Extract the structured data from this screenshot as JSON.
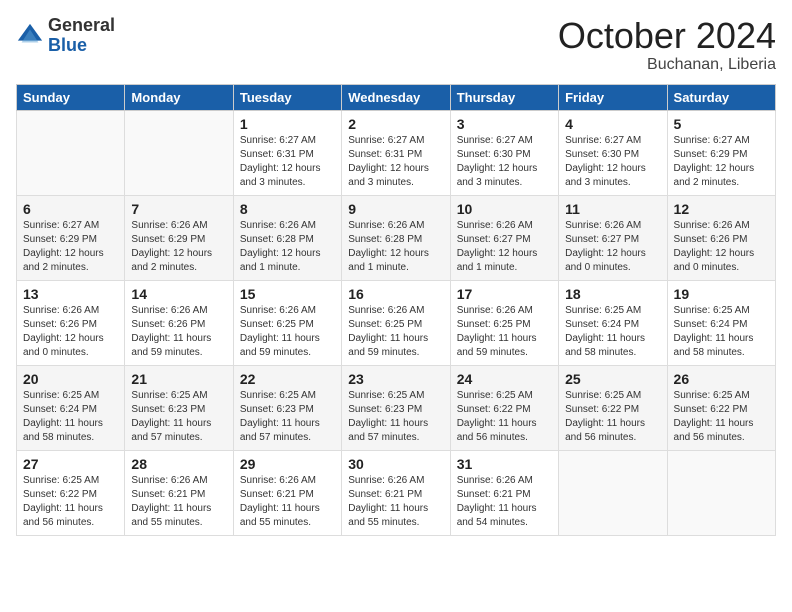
{
  "logo": {
    "general": "General",
    "blue": "Blue"
  },
  "header": {
    "month": "October 2024",
    "location": "Buchanan, Liberia"
  },
  "weekdays": [
    "Sunday",
    "Monday",
    "Tuesday",
    "Wednesday",
    "Thursday",
    "Friday",
    "Saturday"
  ],
  "weeks": [
    [
      {
        "day": null,
        "info": null
      },
      {
        "day": null,
        "info": null
      },
      {
        "day": "1",
        "info": "Sunrise: 6:27 AM\nSunset: 6:31 PM\nDaylight: 12 hours and 3 minutes."
      },
      {
        "day": "2",
        "info": "Sunrise: 6:27 AM\nSunset: 6:31 PM\nDaylight: 12 hours and 3 minutes."
      },
      {
        "day": "3",
        "info": "Sunrise: 6:27 AM\nSunset: 6:30 PM\nDaylight: 12 hours and 3 minutes."
      },
      {
        "day": "4",
        "info": "Sunrise: 6:27 AM\nSunset: 6:30 PM\nDaylight: 12 hours and 3 minutes."
      },
      {
        "day": "5",
        "info": "Sunrise: 6:27 AM\nSunset: 6:29 PM\nDaylight: 12 hours and 2 minutes."
      }
    ],
    [
      {
        "day": "6",
        "info": "Sunrise: 6:27 AM\nSunset: 6:29 PM\nDaylight: 12 hours and 2 minutes."
      },
      {
        "day": "7",
        "info": "Sunrise: 6:26 AM\nSunset: 6:29 PM\nDaylight: 12 hours and 2 minutes."
      },
      {
        "day": "8",
        "info": "Sunrise: 6:26 AM\nSunset: 6:28 PM\nDaylight: 12 hours and 1 minute."
      },
      {
        "day": "9",
        "info": "Sunrise: 6:26 AM\nSunset: 6:28 PM\nDaylight: 12 hours and 1 minute."
      },
      {
        "day": "10",
        "info": "Sunrise: 6:26 AM\nSunset: 6:27 PM\nDaylight: 12 hours and 1 minute."
      },
      {
        "day": "11",
        "info": "Sunrise: 6:26 AM\nSunset: 6:27 PM\nDaylight: 12 hours and 0 minutes."
      },
      {
        "day": "12",
        "info": "Sunrise: 6:26 AM\nSunset: 6:26 PM\nDaylight: 12 hours and 0 minutes."
      }
    ],
    [
      {
        "day": "13",
        "info": "Sunrise: 6:26 AM\nSunset: 6:26 PM\nDaylight: 12 hours and 0 minutes."
      },
      {
        "day": "14",
        "info": "Sunrise: 6:26 AM\nSunset: 6:26 PM\nDaylight: 11 hours and 59 minutes."
      },
      {
        "day": "15",
        "info": "Sunrise: 6:26 AM\nSunset: 6:25 PM\nDaylight: 11 hours and 59 minutes."
      },
      {
        "day": "16",
        "info": "Sunrise: 6:26 AM\nSunset: 6:25 PM\nDaylight: 11 hours and 59 minutes."
      },
      {
        "day": "17",
        "info": "Sunrise: 6:26 AM\nSunset: 6:25 PM\nDaylight: 11 hours and 59 minutes."
      },
      {
        "day": "18",
        "info": "Sunrise: 6:25 AM\nSunset: 6:24 PM\nDaylight: 11 hours and 58 minutes."
      },
      {
        "day": "19",
        "info": "Sunrise: 6:25 AM\nSunset: 6:24 PM\nDaylight: 11 hours and 58 minutes."
      }
    ],
    [
      {
        "day": "20",
        "info": "Sunrise: 6:25 AM\nSunset: 6:24 PM\nDaylight: 11 hours and 58 minutes."
      },
      {
        "day": "21",
        "info": "Sunrise: 6:25 AM\nSunset: 6:23 PM\nDaylight: 11 hours and 57 minutes."
      },
      {
        "day": "22",
        "info": "Sunrise: 6:25 AM\nSunset: 6:23 PM\nDaylight: 11 hours and 57 minutes."
      },
      {
        "day": "23",
        "info": "Sunrise: 6:25 AM\nSunset: 6:23 PM\nDaylight: 11 hours and 57 minutes."
      },
      {
        "day": "24",
        "info": "Sunrise: 6:25 AM\nSunset: 6:22 PM\nDaylight: 11 hours and 56 minutes."
      },
      {
        "day": "25",
        "info": "Sunrise: 6:25 AM\nSunset: 6:22 PM\nDaylight: 11 hours and 56 minutes."
      },
      {
        "day": "26",
        "info": "Sunrise: 6:25 AM\nSunset: 6:22 PM\nDaylight: 11 hours and 56 minutes."
      }
    ],
    [
      {
        "day": "27",
        "info": "Sunrise: 6:25 AM\nSunset: 6:22 PM\nDaylight: 11 hours and 56 minutes."
      },
      {
        "day": "28",
        "info": "Sunrise: 6:26 AM\nSunset: 6:21 PM\nDaylight: 11 hours and 55 minutes."
      },
      {
        "day": "29",
        "info": "Sunrise: 6:26 AM\nSunset: 6:21 PM\nDaylight: 11 hours and 55 minutes."
      },
      {
        "day": "30",
        "info": "Sunrise: 6:26 AM\nSunset: 6:21 PM\nDaylight: 11 hours and 55 minutes."
      },
      {
        "day": "31",
        "info": "Sunrise: 6:26 AM\nSunset: 6:21 PM\nDaylight: 11 hours and 54 minutes."
      },
      {
        "day": null,
        "info": null
      },
      {
        "day": null,
        "info": null
      }
    ]
  ]
}
